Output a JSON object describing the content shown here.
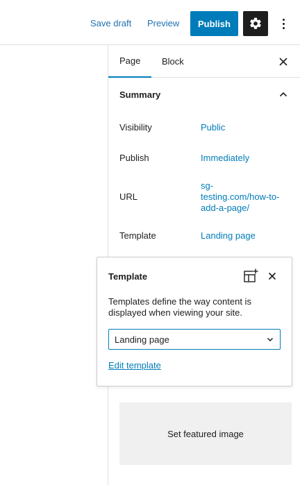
{
  "topbar": {
    "save_draft_label": "Save draft",
    "preview_label": "Preview",
    "publish_label": "Publish",
    "settings_icon": "gear-icon",
    "more_icon": "vertical-ellipsis-icon"
  },
  "sidebar": {
    "tabs": [
      {
        "label": "Page",
        "active": true
      },
      {
        "label": "Block",
        "active": false
      }
    ],
    "close_icon": "close-icon",
    "summary": {
      "title": "Summary",
      "toggle_icon": "chevron-up-icon",
      "rows": [
        {
          "label": "Visibility",
          "value": "Public"
        },
        {
          "label": "Publish",
          "value": "Immediately"
        },
        {
          "label": "URL",
          "value_lines": [
            "sg-",
            "testing.com/how-to-",
            "add-a-page/"
          ]
        },
        {
          "label": "Template",
          "value": "Landing page"
        }
      ]
    },
    "featured_image": {
      "button_label": "Set featured image"
    }
  },
  "template_popover": {
    "title": "Template",
    "add_icon": "add-template-icon",
    "close_icon": "close-icon",
    "description": "Templates define the way content is displayed when viewing your site.",
    "select_value": "Landing page",
    "edit_link": "Edit template"
  },
  "colors": {
    "accent": "#007cba",
    "dark": "#1e1e1e",
    "border": "#e0e0e0",
    "placeholder_bg": "#f0f0f0"
  }
}
